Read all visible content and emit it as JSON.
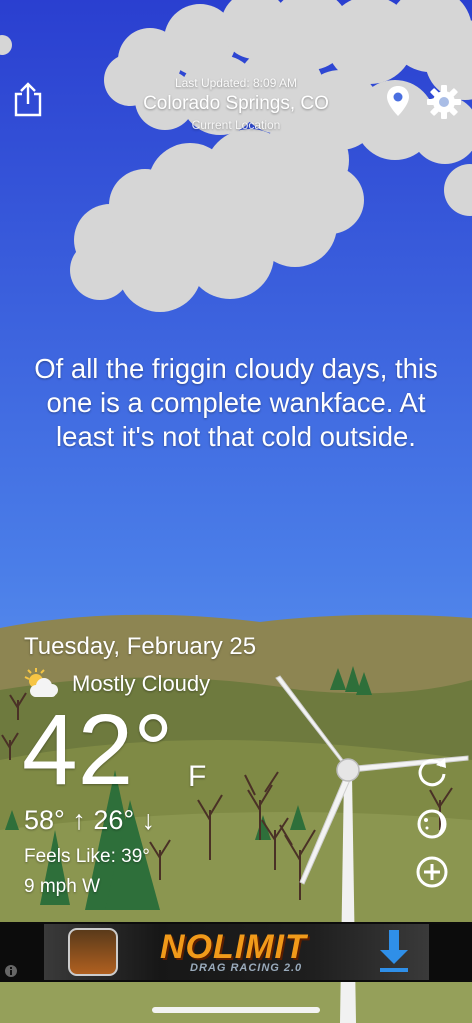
{
  "header": {
    "last_updated": "Last Updated: 8:09 AM",
    "city": "Colorado Springs, CO",
    "location_label": "Current Location",
    "share_icon": "share-icon",
    "location_icon": "location-pin-icon",
    "settings_icon": "gear-icon"
  },
  "message": "Of all the friggin cloudy days, this one is a complete wankface. At least it's not that cold outside.",
  "weather": {
    "date": "Tuesday, February 25",
    "condition": "Mostly Cloudy",
    "condition_icon": "partly-cloudy-icon",
    "temperature": "42°",
    "unit": "F",
    "high_low": "58° ↑ 26° ↓",
    "feels_like": "Feels Like: 39°",
    "wind": "9 mph W"
  },
  "actions": {
    "refresh_icon": "refresh-icon",
    "moon_icon": "moon-icon",
    "add_icon": "add-icon"
  },
  "ad": {
    "title": "NOLIMIT",
    "subtitle": "DRAG RACING 2.0",
    "download_icon": "download-icon",
    "info_icon": "info-icon"
  },
  "colors": {
    "sky_top": "#2a3fd0",
    "sky_bottom": "#6aa8f4",
    "hills": "#8b8556",
    "ad_orange": "#f19a1a"
  }
}
